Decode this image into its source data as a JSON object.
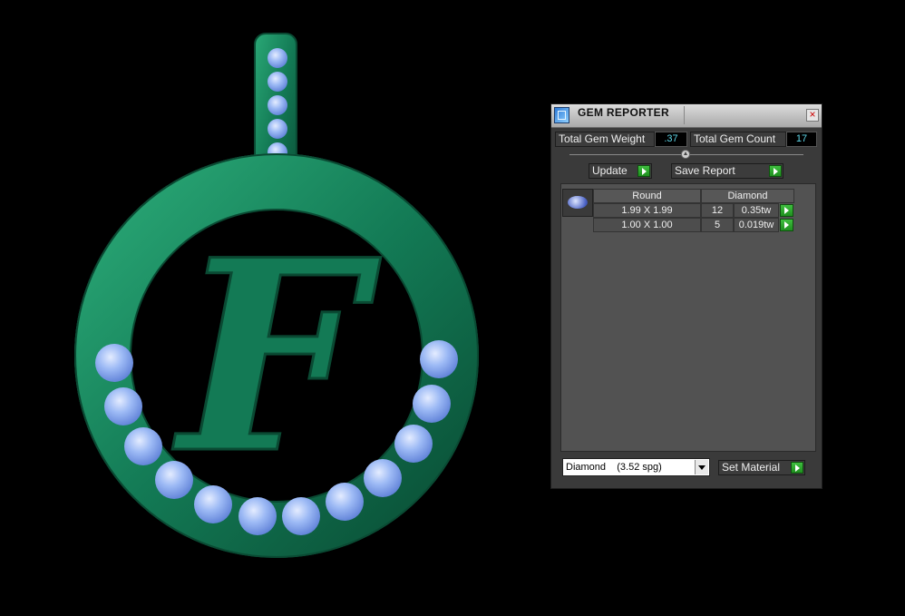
{
  "window": {
    "title": "GEM REPORTER"
  },
  "stats": {
    "weight_label": "Total Gem Weight",
    "weight_value": ".37",
    "count_label": "Total Gem Count",
    "count_value": "17"
  },
  "actions": {
    "update_label": "Update",
    "save_label": "Save Report"
  },
  "report": {
    "columns": [
      "Round",
      "Diamond"
    ],
    "rows": [
      {
        "size": "1.99 X 1.99",
        "count": "12",
        "weight": "0.35tw"
      },
      {
        "size": "1.00 X 1.00",
        "count": "5",
        "weight": "0.019tw"
      }
    ]
  },
  "material": {
    "selected": "Diamond    (3.52 spg)",
    "set_label": "Set Material"
  },
  "viewport": {
    "letter": "F",
    "metal_color": "#137a55",
    "gem_color": "#7ea6f0"
  }
}
